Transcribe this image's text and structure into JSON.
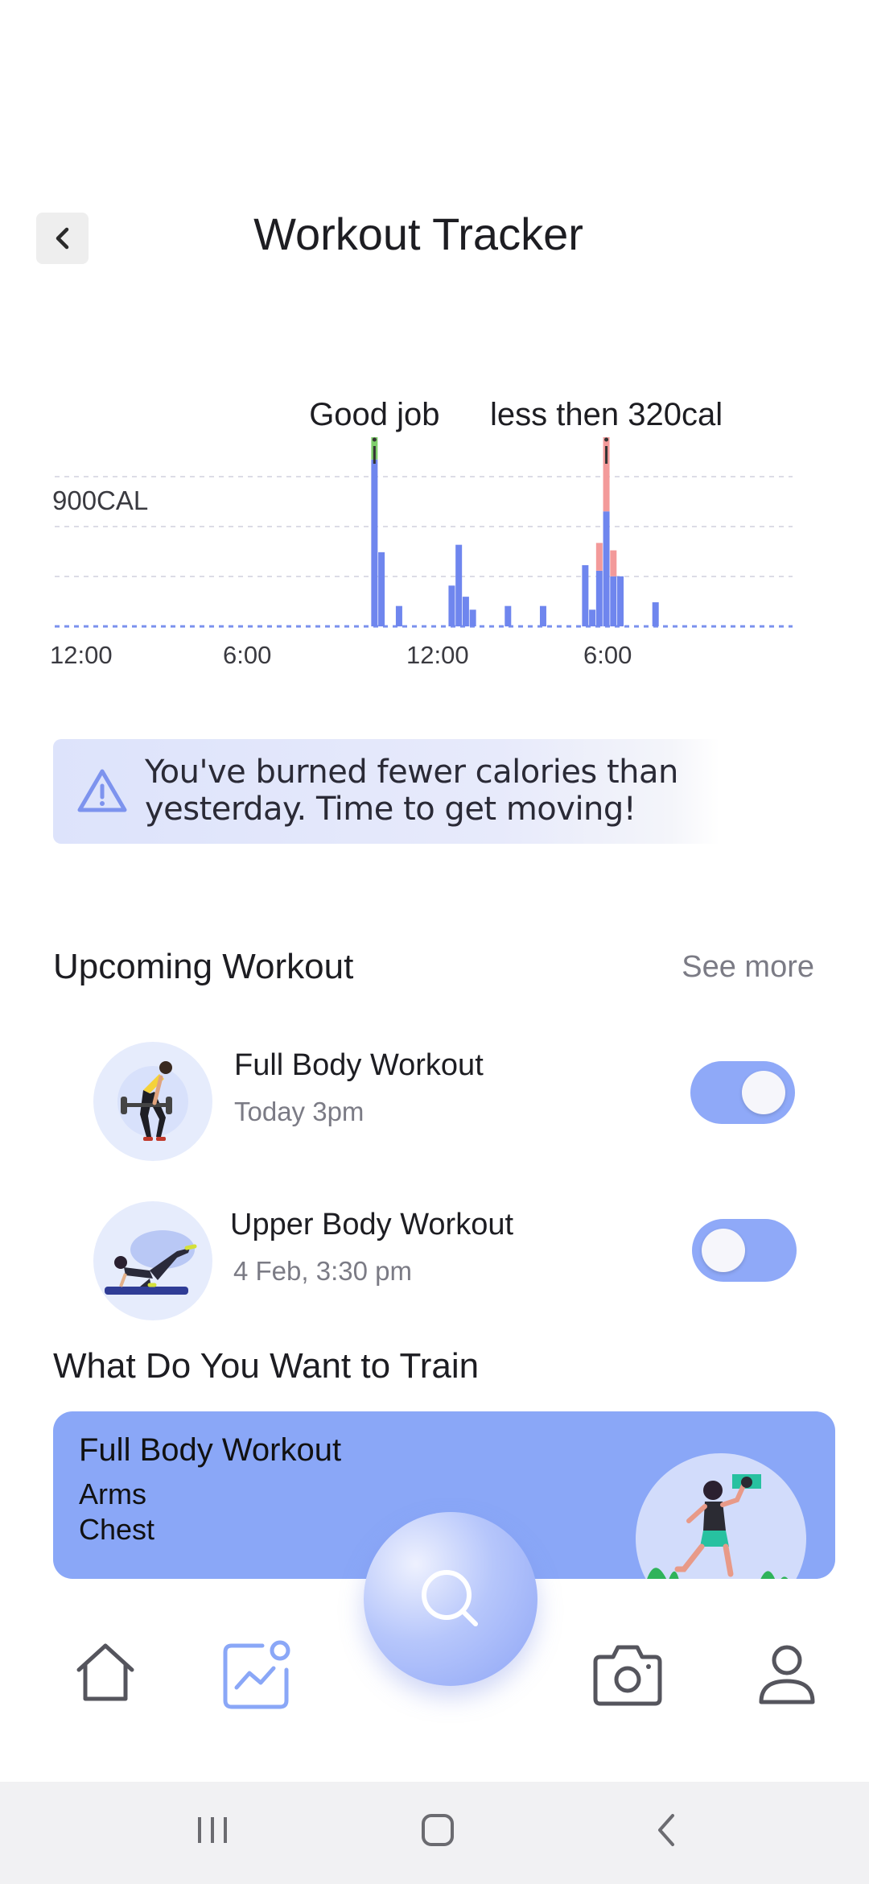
{
  "header": {
    "title": "Workout Tracker",
    "back_icon": "chevron-left-icon"
  },
  "chart_data": {
    "type": "bar",
    "ylabel": "",
    "y_tick_label": "900CAL",
    "x_tick_labels": [
      "12:00",
      "6:00",
      "12:00",
      "6:00"
    ],
    "annotations": [
      {
        "text": "Good job",
        "marker_color": "#7fcf6b"
      },
      {
        "text": "less then 320cal",
        "marker_color": "#f39a9a"
      }
    ],
    "series": [
      {
        "values": [
          0,
          0,
          0,
          0,
          0,
          0,
          0,
          0,
          0,
          0,
          0,
          0,
          0,
          0,
          0,
          0,
          0,
          0,
          0,
          0,
          0,
          0,
          0,
          0,
          0,
          0,
          0,
          0,
          0,
          0,
          0,
          0,
          0,
          0,
          0,
          0,
          0,
          0,
          0,
          0,
          0,
          0,
          0,
          0,
          0,
          0,
          0,
          0,
          0,
          0,
          0,
          0,
          0,
          0,
          0,
          0,
          0,
          0,
          0,
          0,
          0,
          0,
          0,
          0,
          0,
          0,
          0,
          0,
          0,
          0,
          0,
          0,
          0,
          0,
          0,
          0,
          0,
          0,
          0,
          0,
          0,
          0,
          0,
          0,
          0,
          0,
          0,
          0,
          0,
          0,
          0,
          0,
          0,
          0,
          0,
          0,
          0,
          0,
          0,
          0,
          0,
          0,
          0,
          0,
          0,
          0,
          0,
          0,
          0,
          0,
          0,
          0,
          0,
          0,
          0,
          0,
          0,
          0,
          0,
          0,
          0,
          0,
          0,
          0,
          0,
          0,
          0,
          0,
          0,
          0,
          0,
          0,
          0,
          0,
          0,
          0,
          0,
          0,
          0,
          0,
          0,
          0,
          0,
          0,
          0,
          0,
          0,
          0,
          0,
          0
        ]
      }
    ],
    "bars": [
      {
        "x": 9.1,
        "blue": 900,
        "top_color": "#7fcf6b",
        "top": 120
      },
      {
        "x": 9.3,
        "blue": 400
      },
      {
        "x": 9.8,
        "blue": 110
      },
      {
        "x": 11.3,
        "blue": 220
      },
      {
        "x": 11.5,
        "blue": 440
      },
      {
        "x": 11.7,
        "blue": 160
      },
      {
        "x": 11.9,
        "blue": 90
      },
      {
        "x": 12.9,
        "blue": 110
      },
      {
        "x": 13.9,
        "blue": 110
      },
      {
        "x": 15.1,
        "blue": 330
      },
      {
        "x": 15.3,
        "blue": 90
      },
      {
        "x": 15.5,
        "blue": 300,
        "top_color": "#f39a9a",
        "top": 150
      },
      {
        "x": 15.7,
        "blue": 620,
        "top_color": "#f39a9a",
        "top": 400
      },
      {
        "x": 15.9,
        "blue": 270,
        "top_color": "#f39a9a",
        "top": 140
      },
      {
        "x": 16.1,
        "blue": 270
      },
      {
        "x": 17.1,
        "blue": 130
      }
    ],
    "ymax": 1120,
    "xmin": 0,
    "xmax": 21
  },
  "alert": {
    "icon": "warning-triangle-icon",
    "text_line1": "You've burned fewer calories than",
    "text_line2": "yesterday. Time to get moving!"
  },
  "upcoming": {
    "title": "Upcoming Workout",
    "see_more": "See more",
    "items": [
      {
        "name": "Full Body Workout",
        "time": "Today 3pm",
        "enabled": true
      },
      {
        "name": "Upper Body Workout",
        "time": "4 Feb, 3:30 pm",
        "enabled": false
      }
    ]
  },
  "train": {
    "title": "What Do You Want to Train",
    "card_title": "Full Body Workout",
    "card_line1": "Arms",
    "card_line2": "Chest"
  },
  "bottom_nav": {
    "items": [
      "home-icon",
      "activity-chart-icon",
      "search-icon",
      "camera-icon",
      "profile-icon"
    ],
    "active": "activity-chart-icon"
  },
  "colors": {
    "accent": "#8aa7f7",
    "chart_blue": "#6f86ee",
    "alert_bg": "#dde3fb"
  }
}
